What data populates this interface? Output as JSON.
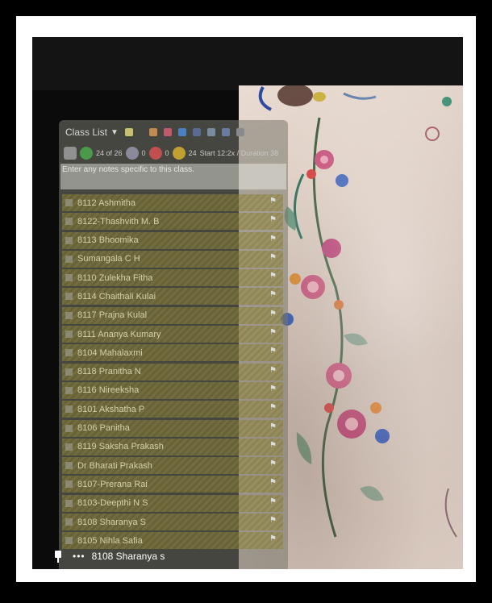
{
  "class_list": {
    "title": "Class List",
    "toolbar": {
      "count_present": "24 of 26",
      "count_a": "0",
      "count_b": "0",
      "count_c": "24",
      "start_label": "Start 12:2x / Duration 38"
    },
    "notes_placeholder": "Enter any notes specific to this class.",
    "students": [
      "8112 Ashmitha",
      "8122-Thashvith M. B",
      "8113 Bhoomika",
      "Sumangala C H",
      "8110 Zulekha Fitha",
      "8114 Chaithali Kulai",
      "8117 Prajna Kulal",
      "8111 Ananya Kumary",
      "8104 Mahalaxmi",
      "8118 Pranitha N",
      "8116 Nireeksha",
      "8101 Akshatha P",
      "8106 Panitha",
      "8119 Saksha Prakash",
      "Dr Bharati Prakash",
      "8107-Prerana Rai",
      "8103-Deepthi N S",
      "8108 Sharanya S",
      "8105 Nihla Safia"
    ]
  },
  "bottom": {
    "dots": "•••",
    "name": "8108 Sharanya s"
  }
}
